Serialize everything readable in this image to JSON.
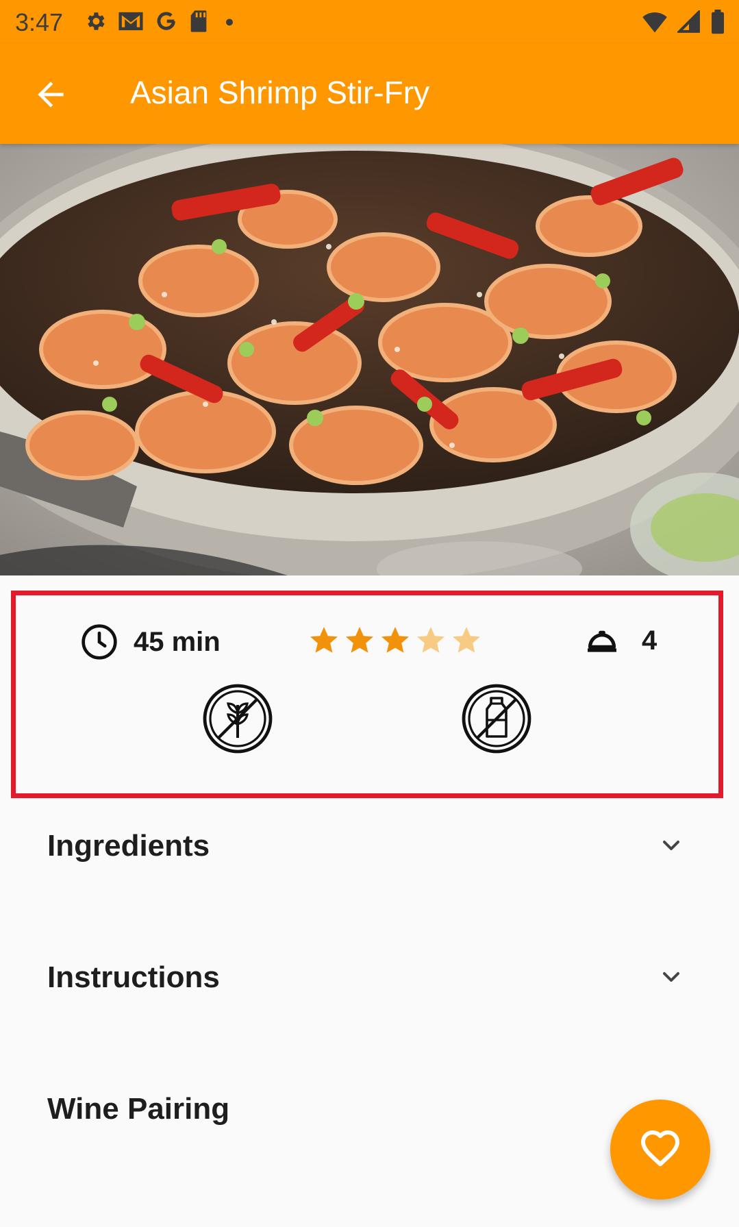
{
  "status_bar": {
    "time": "3:47",
    "left_icons": [
      "gear-icon",
      "gmail-icon",
      "google-icon",
      "sd-card-icon",
      "dot-icon"
    ],
    "right_icons": [
      "wifi-icon",
      "signal-icon",
      "battery-icon"
    ]
  },
  "app_bar": {
    "title": "Asian Shrimp Stir-Fry",
    "back_icon": "arrow-back-icon",
    "background": "#ff9800"
  },
  "hero": {
    "image": "shrimp-stir-fry-photo"
  },
  "info": {
    "time": "45 min",
    "rating": 3,
    "rating_max": 5,
    "servings": "4",
    "diet_icons": [
      "gluten-free-icon",
      "dairy-free-icon"
    ],
    "highlight_color": "#e3192c"
  },
  "sections": [
    {
      "label": "Ingredients",
      "icon": "chevron-down-icon"
    },
    {
      "label": "Instructions",
      "icon": "chevron-down-icon"
    },
    {
      "label": "Wine Pairing"
    }
  ],
  "fab": {
    "icon": "heart-outline-icon",
    "color": "#ff9800"
  }
}
